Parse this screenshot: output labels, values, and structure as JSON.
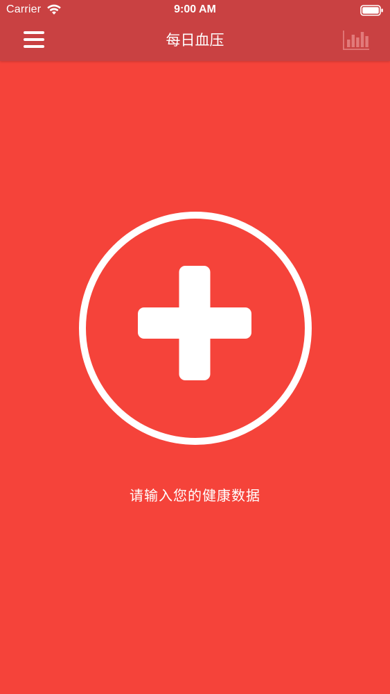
{
  "status_bar": {
    "carrier": "Carrier",
    "time": "9:00 AM",
    "icons": [
      "wifi-icon",
      "battery-icon"
    ]
  },
  "nav_bar": {
    "title": "每日血压",
    "left_icon": "menu-icon",
    "right_icon": "bar-chart-icon"
  },
  "main": {
    "add_icon": "plus-circle-icon",
    "prompt": "请输入您的健康数据"
  },
  "colors": {
    "background": "#f5433a",
    "nav_bar": "#c94142",
    "foreground": "#ffffff",
    "chart_icon_dimmed": "#e27a7a"
  }
}
